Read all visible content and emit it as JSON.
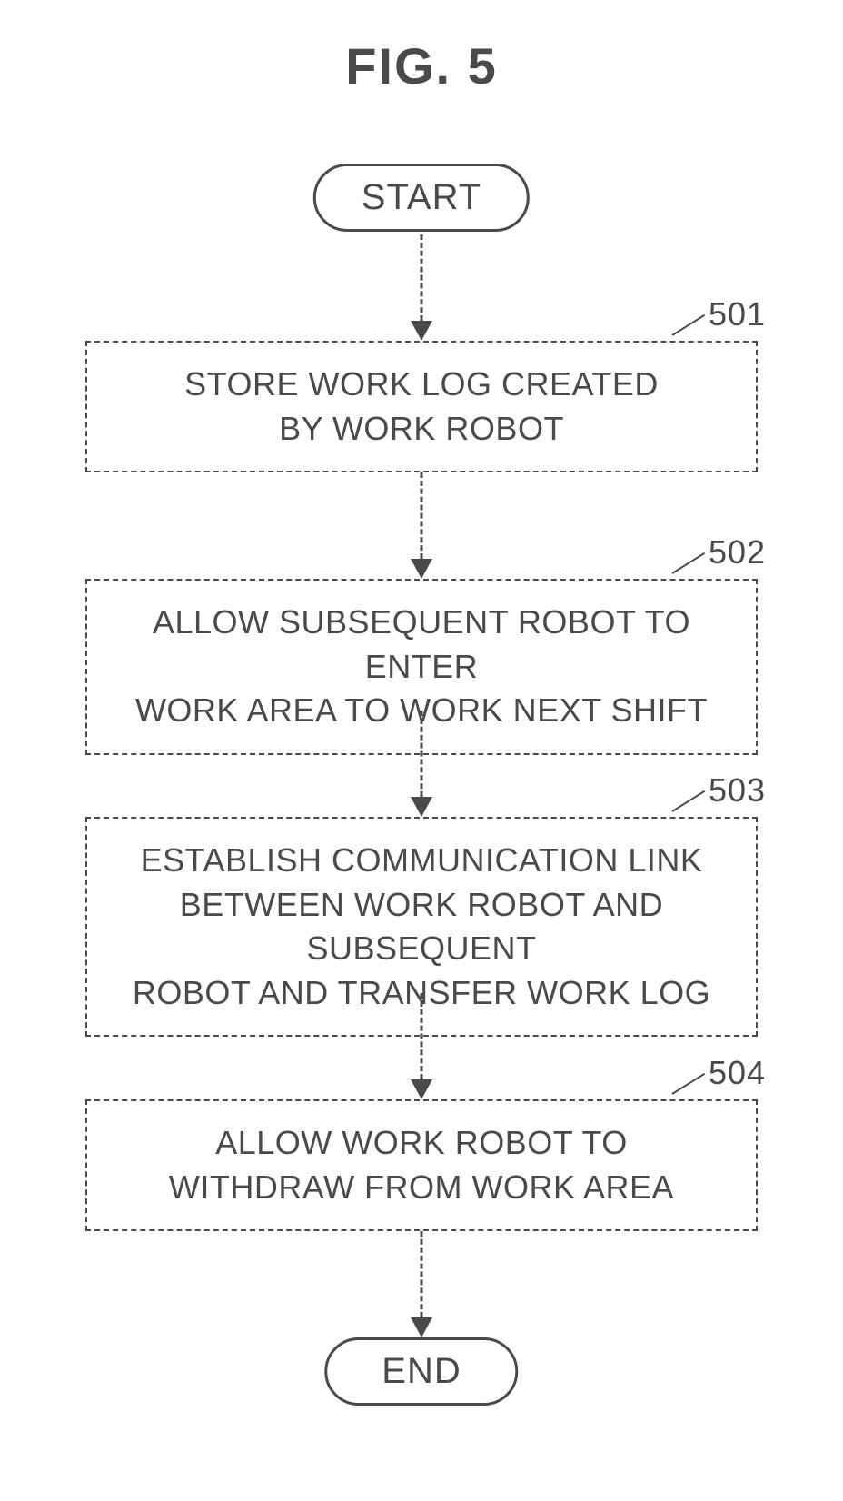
{
  "figure_title": "FIG. 5",
  "start_label": "START",
  "end_label": "END",
  "steps": [
    {
      "id": "501",
      "text": "STORE WORK LOG CREATED\nBY WORK ROBOT"
    },
    {
      "id": "502",
      "text": "ALLOW SUBSEQUENT ROBOT TO ENTER\nWORK AREA TO WORK NEXT SHIFT"
    },
    {
      "id": "503",
      "text": "ESTABLISH COMMUNICATION LINK\nBETWEEN WORK ROBOT AND SUBSEQUENT\nROBOT AND TRANSFER WORK LOG"
    },
    {
      "id": "504",
      "text": "ALLOW WORK ROBOT TO\nWITHDRAW FROM WORK AREA"
    }
  ]
}
